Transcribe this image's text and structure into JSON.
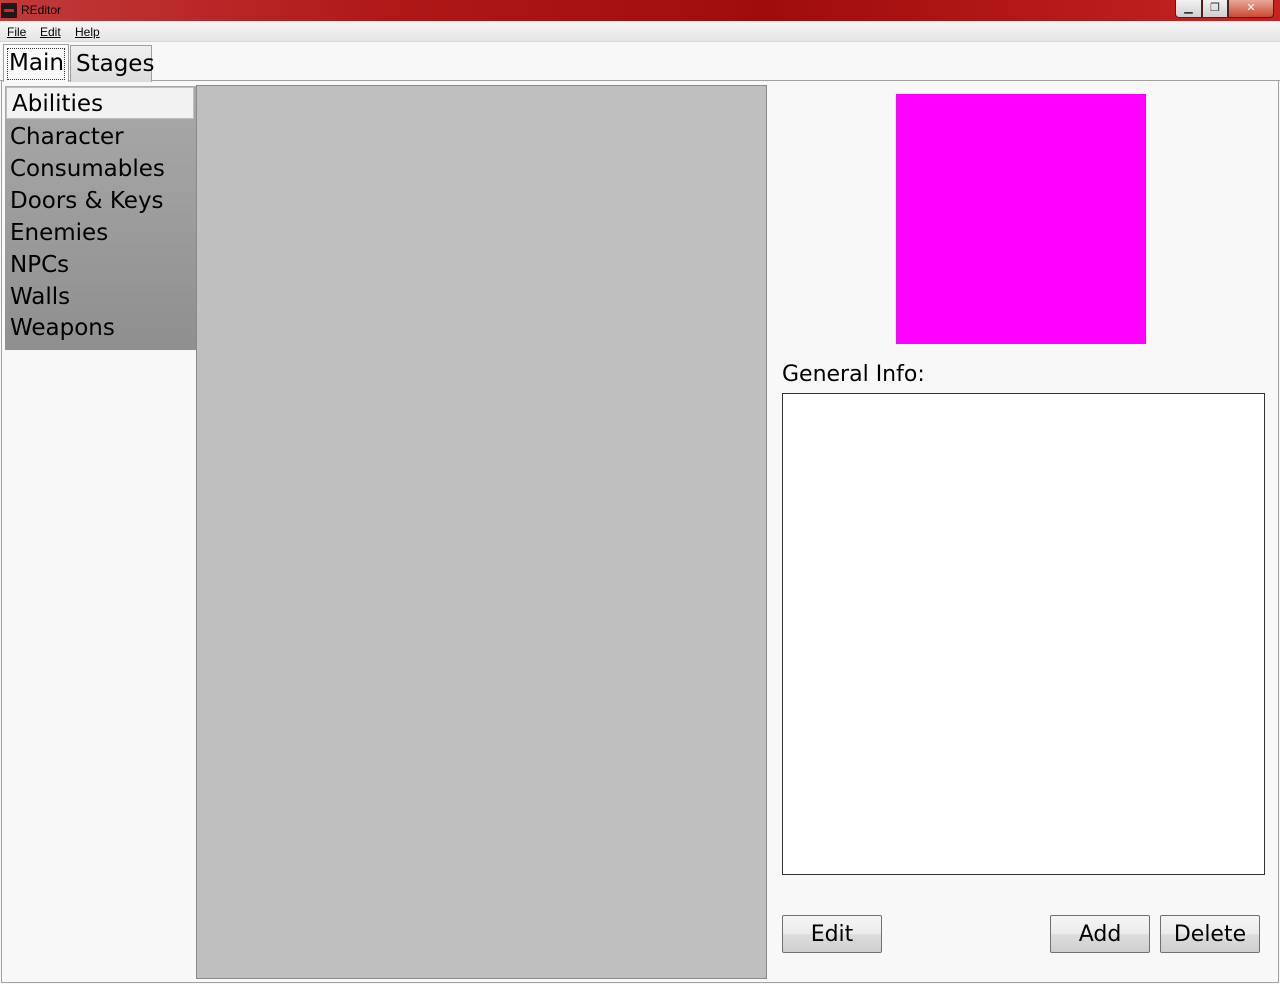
{
  "window": {
    "title": "REditor",
    "controls": {
      "minimize": "▁",
      "maximize": "❐",
      "close": "✕"
    }
  },
  "menu": [
    "File",
    "Edit",
    "Help"
  ],
  "tabs": [
    {
      "label": "Main",
      "selected": true
    },
    {
      "label": "Stages",
      "selected": false
    }
  ],
  "categories": [
    {
      "label": "Abilities",
      "selected": true
    },
    {
      "label": "Character"
    },
    {
      "label": "Consumables"
    },
    {
      "label": "Doors & Keys"
    },
    {
      "label": "Enemies"
    },
    {
      "label": "NPCs"
    },
    {
      "label": "Walls"
    },
    {
      "label": "Weapons"
    }
  ],
  "preview": {
    "color": "#ff00ff"
  },
  "general_info": {
    "label": "General Info:",
    "value": ""
  },
  "buttons": {
    "edit": "Edit",
    "add": "Add",
    "delete": "Delete"
  }
}
